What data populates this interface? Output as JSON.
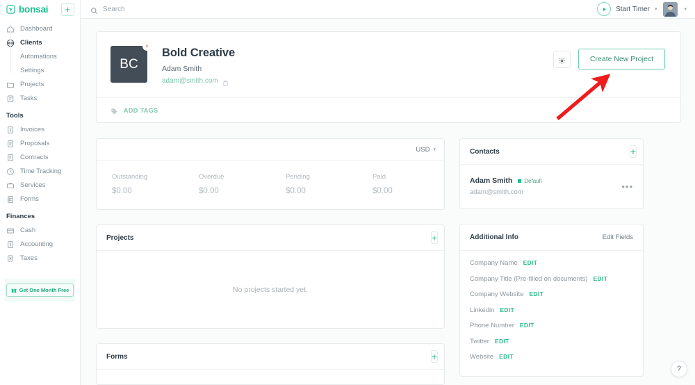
{
  "brand": {
    "name": "bonsai",
    "logo_icon": "bonsai-logo-icon",
    "add_label": "+"
  },
  "sidebar": {
    "items": [
      {
        "label": "Dashboard",
        "icon": "home-icon",
        "type": "item",
        "active": false
      },
      {
        "label": "Clients",
        "icon": "clients-icon",
        "type": "item",
        "active": true
      },
      {
        "label": "Automations",
        "icon": "dot-icon",
        "type": "sub",
        "active": false
      },
      {
        "label": "Settings",
        "icon": "dot-icon",
        "type": "sub",
        "active": false
      },
      {
        "label": "Projects",
        "icon": "folder-icon",
        "type": "item",
        "active": false
      },
      {
        "label": "Tasks",
        "icon": "tasks-icon",
        "type": "item",
        "active": false
      }
    ],
    "groups": [
      {
        "label": "Tools",
        "items": [
          {
            "label": "Invoices",
            "icon": "invoice-icon"
          },
          {
            "label": "Proposals",
            "icon": "proposal-icon"
          },
          {
            "label": "Contracts",
            "icon": "contract-icon"
          },
          {
            "label": "Time Tracking",
            "icon": "clock-icon"
          },
          {
            "label": "Services",
            "icon": "briefcase-icon"
          },
          {
            "label": "Forms",
            "icon": "form-icon"
          }
        ]
      },
      {
        "label": "Finances",
        "items": [
          {
            "label": "Cash",
            "icon": "card-icon"
          },
          {
            "label": "Accounting",
            "icon": "accounting-icon"
          },
          {
            "label": "Taxes",
            "icon": "taxes-icon"
          }
        ]
      }
    ],
    "promo": {
      "label": "Get One Month Free",
      "icon": "gift-icon"
    }
  },
  "topbar": {
    "search_placeholder": "Search",
    "search_value": "",
    "search_icon": "search-icon",
    "timer_label": "Start Timer",
    "timer_icon": "play-icon",
    "caret": "▾"
  },
  "client": {
    "initials": "BC",
    "name": "Bold Creative",
    "contact_person": "Adam Smith",
    "email": "adam@smith.com",
    "remove_icon": "×",
    "gear_icon": "gear-icon",
    "create_project_label": "Create New Project",
    "add_tags_label": "ADD TAGS",
    "tag_icon": "tag-icon"
  },
  "stats": {
    "currency": "USD",
    "caret": "▾",
    "items": [
      {
        "label": "Outstanding",
        "value": "$0.00"
      },
      {
        "label": "Overdue",
        "value": "$0.00"
      },
      {
        "label": "Pending",
        "value": "$0.00"
      },
      {
        "label": "Paid",
        "value": "$0.00"
      }
    ]
  },
  "projects": {
    "title": "Projects",
    "add_label": "+",
    "empty_text": "No projects started yet."
  },
  "forms": {
    "title": "Forms",
    "add_label": "+"
  },
  "contacts": {
    "title": "Contacts",
    "add_label": "+",
    "rows": [
      {
        "name": "Adam Smith",
        "badge": "Default",
        "email": "adam@smith.com",
        "menu": "•••"
      }
    ]
  },
  "additional_info": {
    "title": "Additional Info",
    "edit_fields_label": "Edit Fields",
    "rows": [
      {
        "label": "Company Name",
        "action": "EDIT"
      },
      {
        "label": "Company Title (Pre-filled on documents)",
        "action": "EDIT"
      },
      {
        "label": "Company Website",
        "action": "EDIT"
      },
      {
        "label": "Linkedin",
        "action": "EDIT"
      },
      {
        "label": "Phone Number",
        "action": "EDIT"
      },
      {
        "label": "Twitter",
        "action": "EDIT"
      },
      {
        "label": "Website",
        "action": "EDIT"
      }
    ]
  },
  "help": {
    "label": "?"
  },
  "annotation": {
    "arrow_color": "#ee1c1c"
  },
  "colors": {
    "accent": "#18c08f",
    "text_dark": "#2d3b45",
    "text_muted": "#8d969c",
    "avatar_bg": "#434d57",
    "page_bg": "#fafbfb"
  }
}
